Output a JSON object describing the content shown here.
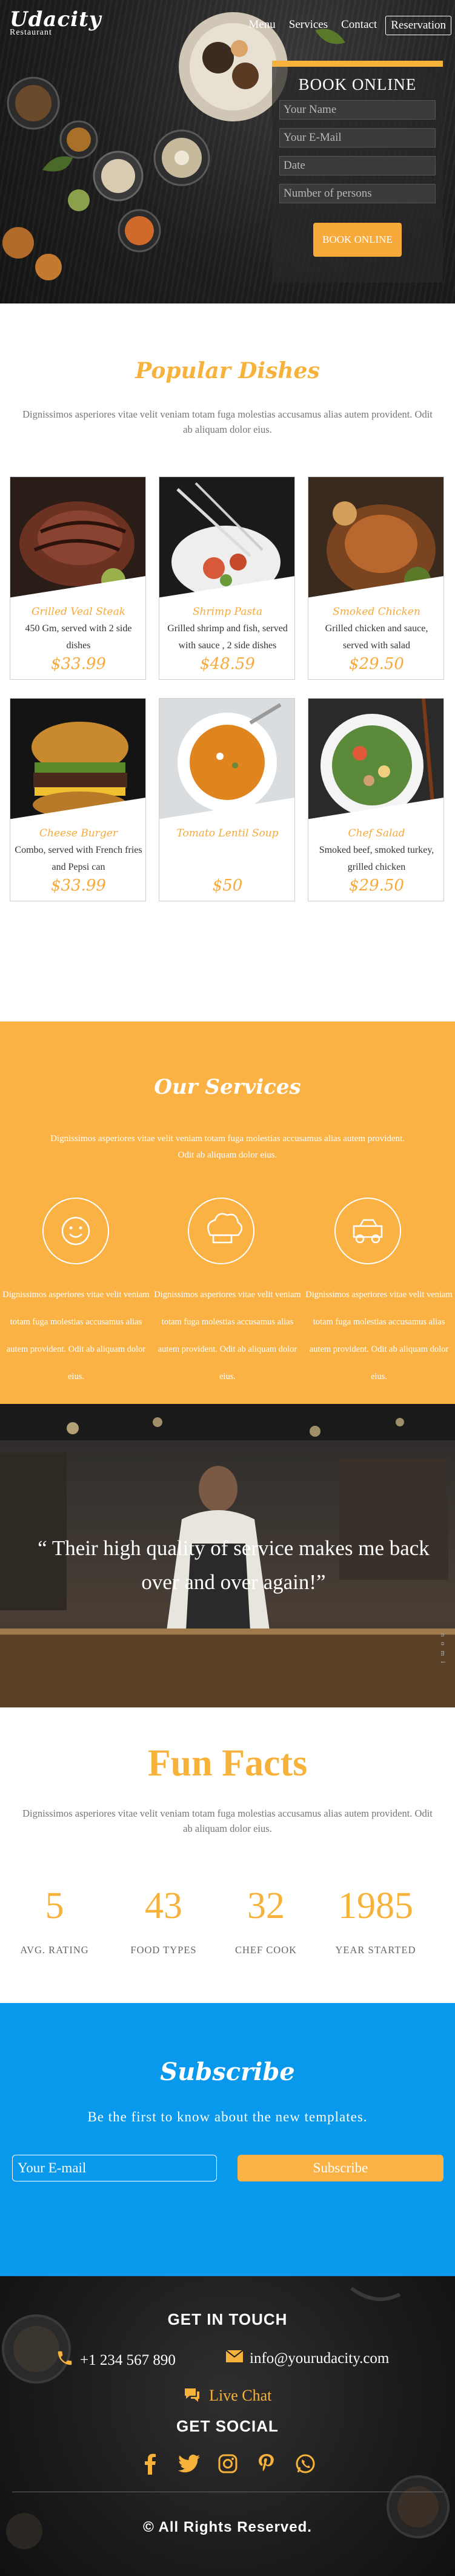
{
  "brand": {
    "name": "Udacity",
    "sub": "Restaurant"
  },
  "nav": {
    "items": [
      "Menu",
      "Services",
      "Contact"
    ],
    "reservation": "Reservation"
  },
  "booking": {
    "title": "BOOK ONLINE",
    "fields": [
      {
        "placeholder": "Your Name"
      },
      {
        "placeholder": "Your E-Mail"
      },
      {
        "placeholder": "Date"
      },
      {
        "placeholder": "Number of persons"
      }
    ],
    "button": "BOOK ONLINE"
  },
  "popular": {
    "title": "Popular Dishes",
    "intro": "Dignissimos asperiores vitae velit veniam totam fuga molestias accusamus alias autem provident. Odit ab aliquam dolor eius.",
    "dishes": [
      {
        "name": "Grilled Veal Steak",
        "desc": "450 Gm, served with 2 side dishes",
        "price": "$33.99"
      },
      {
        "name": "Shrimp Pasta",
        "desc": "Grilled shrimp and fish, served with sauce , 2 side dishes",
        "price": "$48.59"
      },
      {
        "name": "Smoked Chicken",
        "desc": "Grilled chicken and sauce, served with salad",
        "price": "$29.50"
      },
      {
        "name": "Cheese Burger",
        "desc": "Combo, served with French fries and Pepsi can",
        "price": "$33.99"
      },
      {
        "name": "Tomato Lentil Soup",
        "desc": "",
        "price": "$50"
      },
      {
        "name": "Chef Salad",
        "desc": "Smoked beef, smoked turkey, grilled chicken",
        "price": "$29.50"
      }
    ]
  },
  "services": {
    "title": "Our Services",
    "intro": "Dignissimos asperiores vitae velit veniam totam fuga molestias accusamus alias autem provident. Odit ab aliquam dolor eius.",
    "items": [
      {
        "icon": "smiley-icon",
        "text": "Dignissimos asperiores vitae velit veniam totam fuga molestias accusamus alias autem provident. Odit ab aliquam dolor eius."
      },
      {
        "icon": "chef-hat-icon",
        "text": "Dignissimos asperiores vitae velit veniam totam fuga molestias accusamus alias autem provident. Odit ab aliquam dolor eius."
      },
      {
        "icon": "delivery-car-icon",
        "text": "Dignissimos asperiores vitae velit veniam totam fuga molestias accusamus alias autem provident. Odit ab aliquam dolor eius."
      }
    ]
  },
  "testimonial": {
    "quote": "“ Their high quality of service makes me back over and over again!”",
    "side": "n o m i"
  },
  "funfacts": {
    "title": "Fun Facts",
    "intro": "Dignissimos asperiores vitae velit veniam totam fuga molestias accusamus alias autem provident. Odit ab aliquam dolor eius.",
    "facts": [
      {
        "number": "5",
        "label": "AVG. RATING"
      },
      {
        "number": "43",
        "label": "FOOD TYPES"
      },
      {
        "number": "32",
        "label": "CHEF COOK"
      },
      {
        "number": "1985",
        "label": "YEAR STARTED"
      }
    ]
  },
  "subscribe": {
    "title": "Subscribe",
    "lead": "Be the first to know about the new templates.",
    "email_placeholder": "Your E-mail",
    "button": "Subscribe"
  },
  "footer": {
    "get_in_touch": "GET IN TOUCH",
    "phone": "+1 234 567 890",
    "email": "info@yourudacity.com",
    "live_chat": "Live Chat",
    "get_social": "GET SOCIAL",
    "social": [
      "facebook-icon",
      "twitter-icon",
      "instagram-icon",
      "pinterest-icon",
      "whatsapp-icon"
    ],
    "copyright": "© All Rights Reserved."
  },
  "colors": {
    "accent": "#f7b23b",
    "services_bg": "#fab245",
    "subscribe_bg": "#0898ec",
    "dark": "#1f1f1f"
  }
}
